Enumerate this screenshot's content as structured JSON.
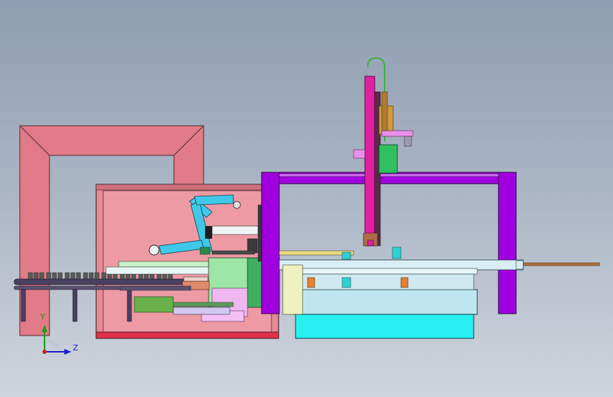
{
  "viewport": {
    "background_top": "#8e9db1",
    "background_bottom": "#cfd5de"
  },
  "triad": {
    "y_label": "Y",
    "z_label": "Z",
    "y_color": "#1a9a1a",
    "z_color": "#1a1acc",
    "origin_color": "#cc1a1a"
  },
  "colors": {
    "enclosure_frame": "#e07b87",
    "gantry": "#a000e0",
    "base_table": "#bfe6f0",
    "base_block": "#28f0f0",
    "conveyor": "#4a4060",
    "robot_arm": "#40c8e8",
    "green_block": "#40d070",
    "magenta_post": "#e020a0"
  }
}
